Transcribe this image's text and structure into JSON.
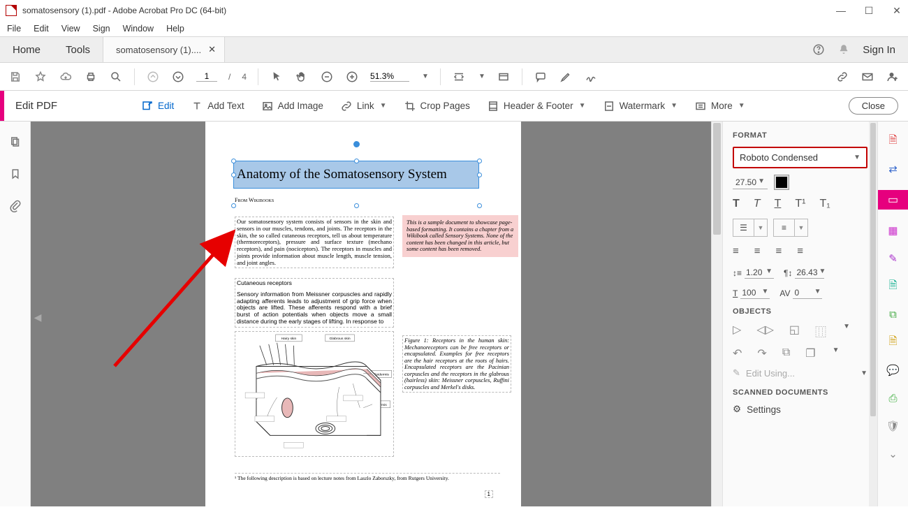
{
  "window": {
    "title": "somatosensory (1).pdf - Adobe Acrobat Pro DC (64-bit)"
  },
  "menubar": [
    "File",
    "Edit",
    "View",
    "Sign",
    "Window",
    "Help"
  ],
  "tabs": {
    "home": "Home",
    "tools": "Tools",
    "doc": "somatosensory (1)....",
    "signin": "Sign In"
  },
  "toolbar": {
    "page_current": "1",
    "page_sep": "/",
    "page_total": "4",
    "zoom": "51.3%"
  },
  "editbar": {
    "title": "Edit PDF",
    "edit": "Edit",
    "addtext": "Add Text",
    "addimage": "Add Image",
    "link": "Link",
    "crop": "Crop Pages",
    "header": "Header & Footer",
    "watermark": "Watermark",
    "more": "More",
    "close": "Close"
  },
  "page": {
    "title": "Anatomy of the Somatosensory System",
    "subtitle": "From Wikibooks",
    "para1": "Our somatosensory system consists of sensors in the skin and sensors in our muscles, tendons, and joints. The receptors in the skin, the so called cutaneous receptors, tell us about temperature (thermoreceptors), pressure and surface texture (mechano receptors), and pain (nociceptors). The receptors in muscles and joints provide information about muscle length, muscle tension, and joint angles.",
    "h2": "Cutaneous receptors",
    "para2": "Sensory information from Meissner corpuscles and rapidly adapting afferents leads to adjustment of grip force when objects are lifted. These afferents respond with a brief burst of action potentials when objects move a small distance during the early stages of lifting. In response to",
    "pinkbox": "This is a sample document to showcase page-based formatting. It contains a chapter from a Wikibook called Sensory Systems. None of the content has been changed in this article, but some content has been removed.",
    "figcap": "Figure 1: Receptors in the human skin: Mechanoreceptors can be free receptors or encapsulated. Examples for free receptors are the hair receptors at the roots of hairs. Encapsulated receptors are the Pacinian corpuscles and the receptors in the glabrous (hairless) skin: Meissner corpuscles, Ruffini corpuscles and Merkel's disks.",
    "labels": {
      "hairy": "Hairy skin",
      "glab": "Glabrous skin",
      "epi": "Epidermis",
      "derm": "Dermis"
    },
    "footnote": "¹ The following description is based on lecture notes from Laszlo Zaborszky, from Rutgers University.",
    "pagenum": "1"
  },
  "format": {
    "hdr": "FORMAT",
    "font": "Roboto Condensed",
    "size": "27.50",
    "sup1": "T¹",
    "sub1": "T₁",
    "line_spacing": "1.20",
    "para_spacing": "26.43",
    "hscale": "100",
    "tracking": "0",
    "objects_hdr": "OBJECTS",
    "editusing": "Edit Using...",
    "scanned_hdr": "SCANNED DOCUMENTS",
    "settings": "Settings"
  }
}
